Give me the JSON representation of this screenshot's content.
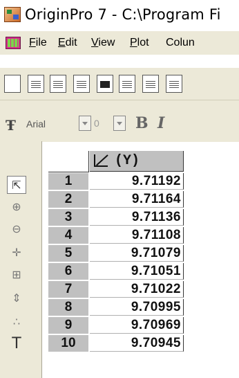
{
  "window": {
    "title": "OriginPro 7 - C:\\Program Fi"
  },
  "menu": {
    "items": [
      {
        "underline": "F",
        "rest": "ile"
      },
      {
        "underline": "E",
        "rest": "dit"
      },
      {
        "underline": "V",
        "rest": "iew"
      },
      {
        "underline": "P",
        "rest": "lot"
      },
      {
        "underline": "",
        "rest": "Colun"
      }
    ]
  },
  "format_bar": {
    "font_name": "Arial",
    "font_size": "0",
    "bold_label": "B",
    "italic_label": "I"
  },
  "tools": [
    "pointer-icon",
    "zoom-in-icon",
    "zoom-out-icon",
    "screen-reader-icon",
    "data-selector-icon",
    "data-reader-icon",
    "mask-icon",
    "text-tool-icon"
  ],
  "worksheet": {
    "column_header": "(Y)",
    "rows": [
      {
        "num": "1",
        "value": "9.71192"
      },
      {
        "num": "2",
        "value": "9.71164"
      },
      {
        "num": "3",
        "value": "9.71136"
      },
      {
        "num": "4",
        "value": "9.71108"
      },
      {
        "num": "5",
        "value": "9.71079"
      },
      {
        "num": "6",
        "value": "9.71051"
      },
      {
        "num": "7",
        "value": "9.71022"
      },
      {
        "num": "8",
        "value": "9.70995"
      },
      {
        "num": "9",
        "value": "9.70969"
      },
      {
        "num": "10",
        "value": "9.70945"
      }
    ]
  }
}
